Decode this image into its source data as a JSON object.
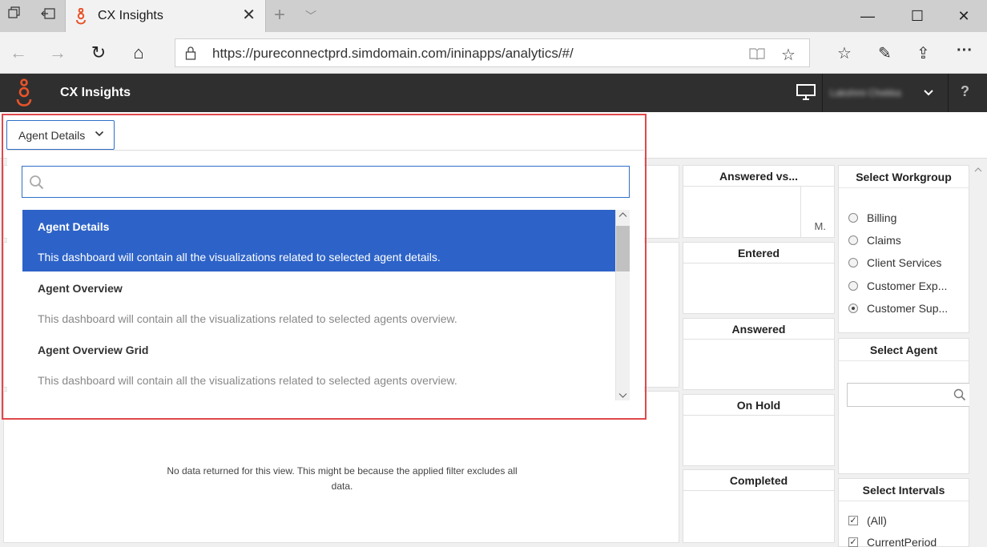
{
  "browser": {
    "tab_title": "CX Insights",
    "url": "https://pureconnectprd.simdomain.com/ininapps/analytics/#/",
    "tab_close_glyph": "✕",
    "new_tab_glyph": "+",
    "tab_list_glyph": "﹀",
    "min_glyph": "—",
    "max_glyph": "☐",
    "close_glyph": "✕",
    "back_glyph": "←",
    "forward_glyph": "→",
    "refresh_glyph": "↻",
    "home_glyph": "⌂",
    "reading_glyph": "📖",
    "favorite_glyph": "☆",
    "favorites_list_glyph": "☆",
    "pen_glyph": "✎",
    "share_glyph": "⇪",
    "more_glyph": "···",
    "accent_color": "#e8542a"
  },
  "app": {
    "title": "CX Insights",
    "user_name": "Lakshmi Chekka",
    "help_label": "?",
    "user_chevron": "⌄"
  },
  "dashboard_selector": {
    "button_label": "Agent Details",
    "search_placeholder": "",
    "items": [
      {
        "name": "Agent Details",
        "description": "This dashboard will contain all the visualizations related to selected agent details.",
        "selected": true
      },
      {
        "name": "Agent Overview",
        "description": "This dashboard will contain all the visualizations related to selected agents overview.",
        "selected": false
      },
      {
        "name": "Agent Overview Grid",
        "description": "This dashboard will contain all the visualizations related to selected agents overview.",
        "selected": false
      }
    ]
  },
  "metrics": {
    "answered_vs": {
      "title": "Answered vs...",
      "label": "M."
    },
    "entered": {
      "title": "Entered"
    },
    "answered": {
      "title": "Answered"
    },
    "on_hold": {
      "title": "On Hold"
    },
    "completed": {
      "title": "Completed"
    }
  },
  "main_panel": {
    "no_data_message": "No data returned for this view. This might be because the applied filter excludes all data."
  },
  "filters": {
    "workgroup": {
      "title": "Select Workgroup",
      "options": [
        {
          "label": "Billing",
          "selected": false
        },
        {
          "label": "Claims",
          "selected": false
        },
        {
          "label": "Client Services",
          "selected": false
        },
        {
          "label": "Customer Exp...",
          "selected": false
        },
        {
          "label": "Customer Sup...",
          "selected": true
        }
      ]
    },
    "agent": {
      "title": "Select Agent",
      "search_placeholder": ""
    },
    "intervals": {
      "title": "Select Intervals",
      "options": [
        {
          "label": "(All)",
          "checked": true
        },
        {
          "label": "CurrentPeriod",
          "checked": true
        }
      ]
    }
  }
}
